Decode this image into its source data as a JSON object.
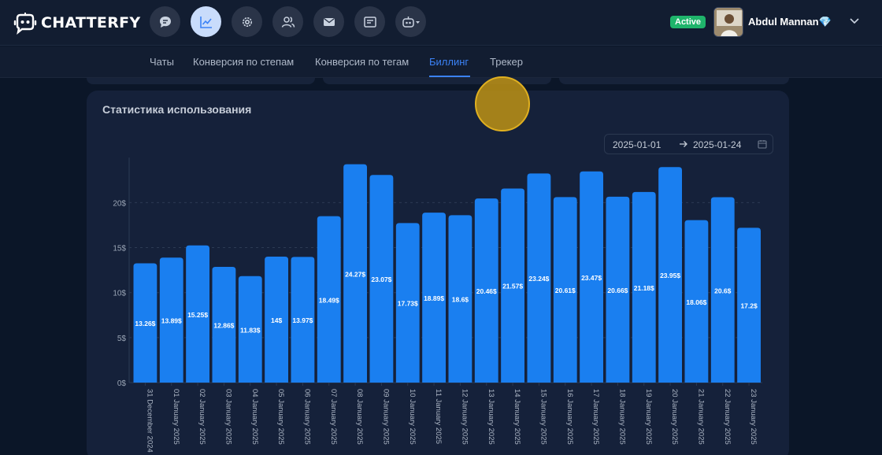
{
  "header": {
    "brand": "CHATTERFY",
    "nav_icons": [
      "chat-icon",
      "analytics-icon",
      "settings-icon",
      "users-icon",
      "mail-icon",
      "forms-icon",
      "bot-icon"
    ],
    "status": "Active",
    "user_name": "Abdul Mannan💎",
    "colors": {
      "accent": "#3b82f6",
      "status": "#1fb46b",
      "background": "#0b1628"
    }
  },
  "tabs": [
    {
      "label": "Чаты"
    },
    {
      "label": "Конверсия по степам"
    },
    {
      "label": "Конверсия по тегам"
    },
    {
      "label": "Биллинг",
      "active": true
    },
    {
      "label": "Трекер"
    }
  ],
  "card": {
    "title": "Статистика использования",
    "date_start": "2025-01-01",
    "date_end": "2025-01-24"
  },
  "chart_data": {
    "type": "bar",
    "title": "",
    "categories": [
      "31 December 2024",
      "01 January 2025",
      "02 January 2025",
      "03 January 2025",
      "04 January 2025",
      "05 January 2025",
      "06 January 2025",
      "07 January 2025",
      "08 January 2025",
      "09 January 2025",
      "10 January 2025",
      "11 January 2025",
      "12 January 2025",
      "13 January 2025",
      "14 January 2025",
      "15 January 2025",
      "16 January 2025",
      "17 January 2025",
      "18 January 2025",
      "19 January 2025",
      "20 January 2025",
      "21 January 2025",
      "22 January 2025",
      "23 January 2025"
    ],
    "values": [
      13.26,
      13.89,
      15.25,
      12.86,
      11.83,
      14,
      13.97,
      18.49,
      24.27,
      23.07,
      17.73,
      18.89,
      18.6,
      20.46,
      21.57,
      23.24,
      20.61,
      23.47,
      20.66,
      21.18,
      23.95,
      18.06,
      20.6,
      17.2
    ],
    "value_labels": [
      "13.26$",
      "13.89$",
      "15.25$",
      "12.86$",
      "11.83$",
      "14$",
      "13.97$",
      "18.49$",
      "24.27$",
      "23.07$",
      "17.73$",
      "18.89$",
      "18.6$",
      "20.46$",
      "21.57$",
      "23.24$",
      "20.61$",
      "23.47$",
      "20.66$",
      "21.18$",
      "23.95$",
      "18.06$",
      "20.6$",
      "17.2$"
    ],
    "yticks": [
      0,
      5,
      10,
      15,
      20
    ],
    "ytick_labels": [
      "0$",
      "5$",
      "10$",
      "15$",
      "20$"
    ],
    "ylim": [
      0,
      25
    ],
    "bar_color": "#1a7ff0",
    "grid": true
  }
}
